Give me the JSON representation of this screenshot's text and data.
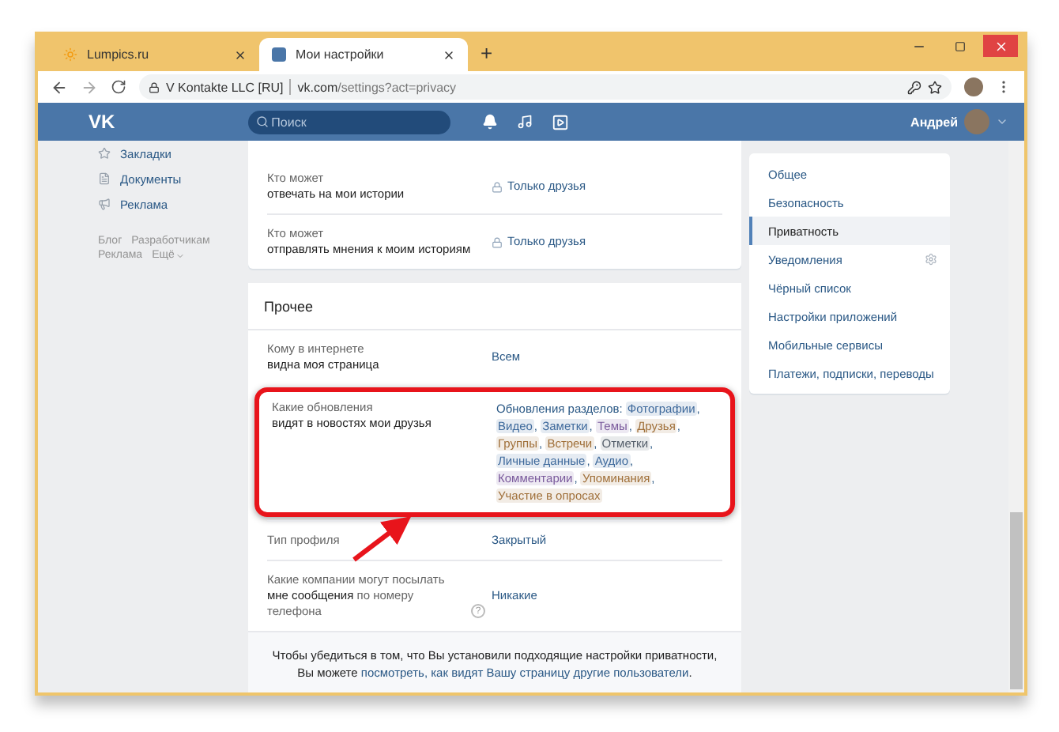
{
  "browser": {
    "tabs": [
      {
        "title": "Lumpics.ru",
        "selected": false
      },
      {
        "title": "Мои настройки",
        "selected": true
      }
    ],
    "new_tab": "+",
    "site_identity": "V Kontakte LLC [RU]",
    "url_host": "vk.com",
    "url_path": "/settings?act=privacy"
  },
  "header": {
    "logo": "VK",
    "search": {
      "placeholder": "Поиск"
    },
    "user_name": "Андрей"
  },
  "sidebar": {
    "items": [
      {
        "label": "Закладки"
      },
      {
        "label": "Документы"
      },
      {
        "label": "Реклама"
      }
    ],
    "footer_links": [
      {
        "label": "Блог",
        "caret": false
      },
      {
        "label": "Разработчикам",
        "caret": false
      },
      {
        "label": "Реклама",
        "caret": false
      },
      {
        "label": "Ещё",
        "caret": true
      }
    ]
  },
  "cards": [
    {
      "rows": [
        {
          "label_top": "Кто может",
          "label": "**отвечать на мои истории**",
          "highlighted": false,
          "value": {
            "kind": "locked",
            "text": "Только друзья"
          }
        },
        {
          "label_top": "Кто может",
          "label": "**отправлять мнения к моим историям**",
          "highlighted": false,
          "value": {
            "kind": "locked",
            "text": "Только друзья"
          }
        }
      ]
    },
    {
      "title": "Прочее",
      "rows": [
        {
          "label_top": "Кому в интернете",
          "label": "**видна моя страница**",
          "highlighted": false,
          "value": {
            "kind": "link",
            "text": "Всем"
          }
        },
        {
          "label_top": "Какие обновления",
          "label": "**видят в новостях мои друзья**",
          "highlighted": true,
          "value": {
            "kind": "tags",
            "prefix": "Обновления разделов:",
            "separator": ",",
            "tags": [
              {
                "text": "Фотографии",
                "color": "#3f6a9c"
              },
              {
                "text": "Видео",
                "color": "#3f6a9c"
              },
              {
                "text": "Заметки",
                "color": "#3f6a9c"
              },
              {
                "text": "Темы",
                "color": "#7a5a9c"
              },
              {
                "text": "Друзья",
                "color": "#a0703a"
              },
              {
                "text": "Группы",
                "color": "#a0703a"
              },
              {
                "text": "Встречи",
                "color": "#a0703a"
              },
              {
                "text": "Отметки",
                "color": "#555f6b"
              },
              {
                "text": "Личные данные",
                "color": "#3f6a9c"
              },
              {
                "text": "Аудио",
                "color": "#3f6a9c"
              },
              {
                "text": "Комментарии",
                "color": "#7a5a9c"
              },
              {
                "text": "Упоминания",
                "color": "#a0703a"
              },
              {
                "text": "Участие в опросах",
                "color": "#a0703a"
              }
            ]
          }
        },
        {
          "label": "Тип профиля",
          "highlighted": false,
          "value": {
            "kind": "link",
            "text": "Закрытый"
          }
        },
        {
          "label": "Какие компании могут посылать **мне сообщения** по номеру телефона",
          "help": "?",
          "highlighted": false,
          "value": {
            "kind": "link",
            "text": "Никакие"
          }
        }
      ],
      "footer": {
        "text": "Чтобы убедиться в том, что Вы установили подходящие настройки приватности, Вы можете",
        "link": "посмотреть, как видят Вашу страницу другие пользователи",
        "end": "."
      }
    }
  ],
  "settings_menu": [
    {
      "label": "Общее",
      "selected": false,
      "gear": false
    },
    {
      "label": "Безопасность",
      "selected": false,
      "gear": false
    },
    {
      "label": "Приватность",
      "selected": true,
      "gear": false
    },
    {
      "label": "Уведомления",
      "selected": false,
      "gear": true
    },
    {
      "label": "Чёрный список",
      "selected": false,
      "gear": false
    },
    {
      "label": "Настройки приложений",
      "selected": false,
      "gear": false
    },
    {
      "label": "Мобильные сервисы",
      "selected": false,
      "gear": false
    },
    {
      "label": "Платежи, подписки, переводы",
      "selected": false,
      "gear": false
    }
  ]
}
